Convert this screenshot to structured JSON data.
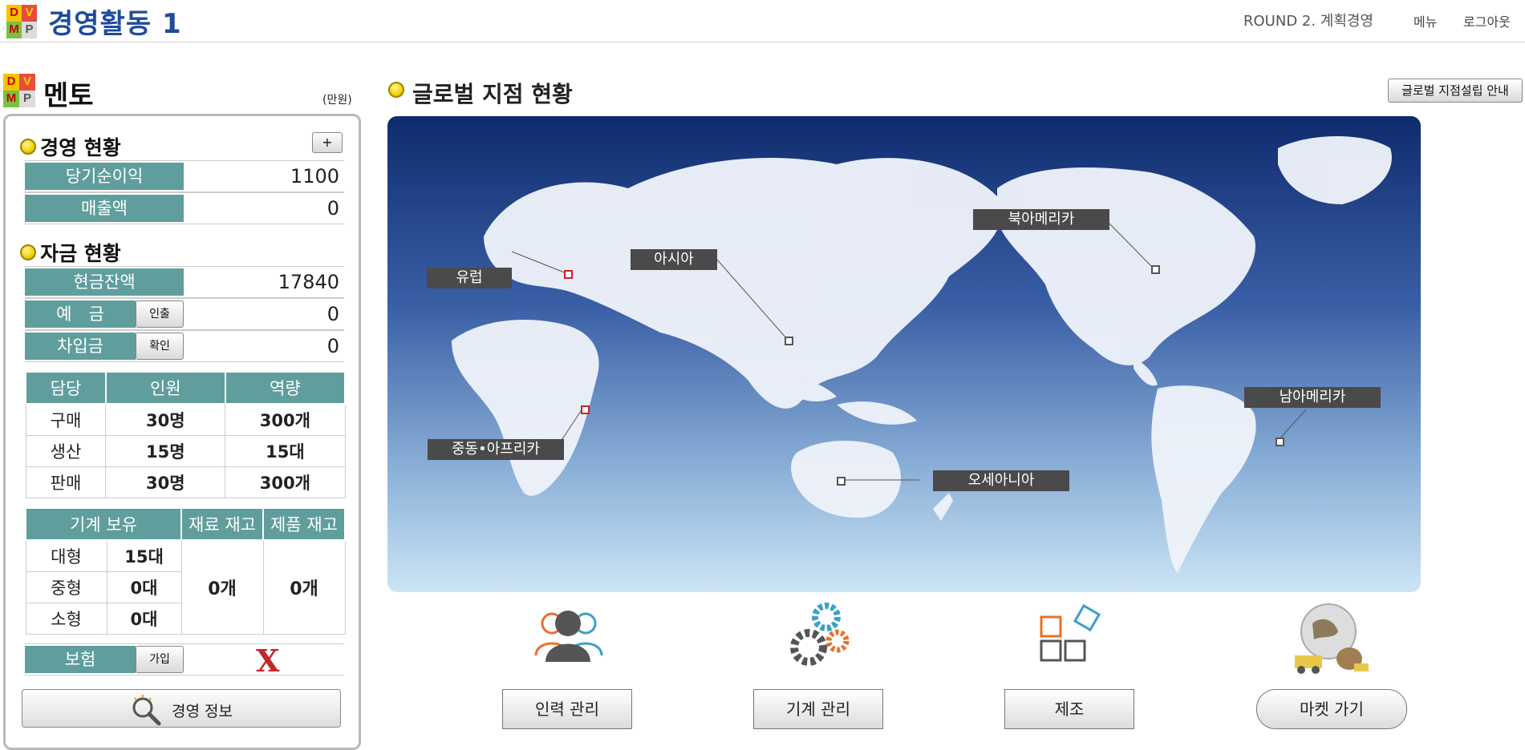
{
  "header": {
    "logo_letters": [
      "D",
      "V",
      "M",
      "P"
    ],
    "title": "경영활동 1",
    "round": "ROUND 2. 계획경영",
    "menu": "메뉴",
    "logout": "로그아웃"
  },
  "left": {
    "mento_title": "멘토",
    "unit": "(만원)",
    "management": {
      "title": "경영 현황",
      "plus_label": "+",
      "rows": [
        {
          "label": "당기순이익",
          "value": "1100"
        },
        {
          "label": "매출액",
          "value": "0"
        }
      ]
    },
    "funds": {
      "title": "자금 현황",
      "rows": [
        {
          "label": "현금잔액",
          "value": "17840"
        },
        {
          "label": "예　금",
          "button": "인출",
          "value": "0"
        },
        {
          "label": "차입금",
          "button": "확인",
          "value": "0"
        }
      ]
    },
    "staff": {
      "headers": [
        "담당",
        "인원",
        "역량"
      ],
      "rows": [
        {
          "role": "구매",
          "count": "30명",
          "capacity": "300개"
        },
        {
          "role": "생산",
          "count": "15명",
          "capacity": "15대"
        },
        {
          "role": "판매",
          "count": "30명",
          "capacity": "300개"
        }
      ]
    },
    "machines": {
      "headers": [
        "기계 보유",
        "재료 재고",
        "제품 재고"
      ],
      "rows": [
        {
          "size": "대형",
          "count": "15대"
        },
        {
          "size": "중형",
          "count": "0대"
        },
        {
          "size": "소형",
          "count": "0대"
        }
      ],
      "material_stock": "0개",
      "product_stock": "0개"
    },
    "insurance": {
      "label": "보험",
      "button": "가입",
      "status": "X"
    },
    "info_button": "경영 정보"
  },
  "right": {
    "global_title": "글로벌 지점 현황",
    "guide_button": "글로벌 지점설립 안내",
    "regions": [
      "유럽",
      "아시아",
      "북아메리카",
      "남아메리카",
      "중동•아프리카",
      "오세아니아"
    ],
    "buttons": [
      "인력 관리",
      "기계 관리",
      "제조",
      "마켓 가기"
    ]
  },
  "colors": {
    "header_title": "#1e4b9a",
    "table_header": "#5f9e9c",
    "insurance_x": "#c0282d",
    "map_top": "#0f2b6e",
    "map_bottom": "#cde5f5"
  }
}
